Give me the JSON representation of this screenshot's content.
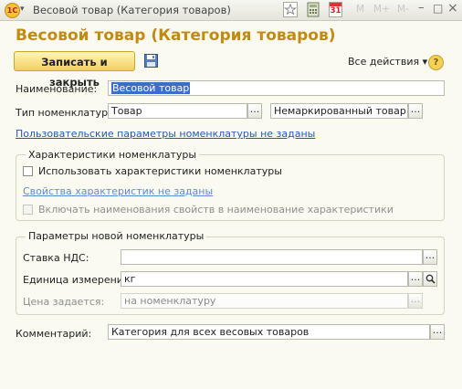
{
  "window": {
    "logo_text": "1С",
    "title": "Весовой товар (Категория товаров)",
    "calendar_day": "31",
    "memory_buttons": [
      "M",
      "M+",
      "M-"
    ],
    "controls": {
      "minimize": "–",
      "maximize": "□",
      "close": "×"
    }
  },
  "form": {
    "title": "Весовой товар (Категория товаров)",
    "toolbar": {
      "save_close_label": "Записать и закрыть",
      "all_actions_label": "Все действия ▾",
      "help_label": "?"
    },
    "name": {
      "label": "Наименование:",
      "value": "Весовой товар"
    },
    "nomenclature_type": {
      "label": "Тип номенклатуры:",
      "value": "Товар",
      "marking_value": "Немаркированный товар"
    },
    "user_params_link": "Пользовательские параметры номенклатуры не заданы",
    "characteristics_group": {
      "caption": "Характеристики номенклатуры",
      "use_characteristics_label": "Использовать характеристики номенклатуры",
      "use_characteristics_checked": false,
      "properties_link": "Свойства характеристик не заданы",
      "include_names_label": "Включать наименования свойств в наименование характеристики",
      "include_names_checked": false
    },
    "new_params_group": {
      "caption": "Параметры новой номенклатуры",
      "vat_label": "Ставка НДС:",
      "vat_value": "",
      "unit_label": "Единица измерения:",
      "unit_value": "кг",
      "price_label": "Цена задается:",
      "price_value": "на номенклатуру"
    },
    "comment": {
      "label": "Комментарий:",
      "value": "Категория для всех весовых товаров"
    },
    "select_button_label": "..."
  },
  "colors": {
    "title_accent": "#c28a10",
    "primary_button": "#f2d060",
    "link": "#2a56b8",
    "selection": "#3b6ec8"
  }
}
